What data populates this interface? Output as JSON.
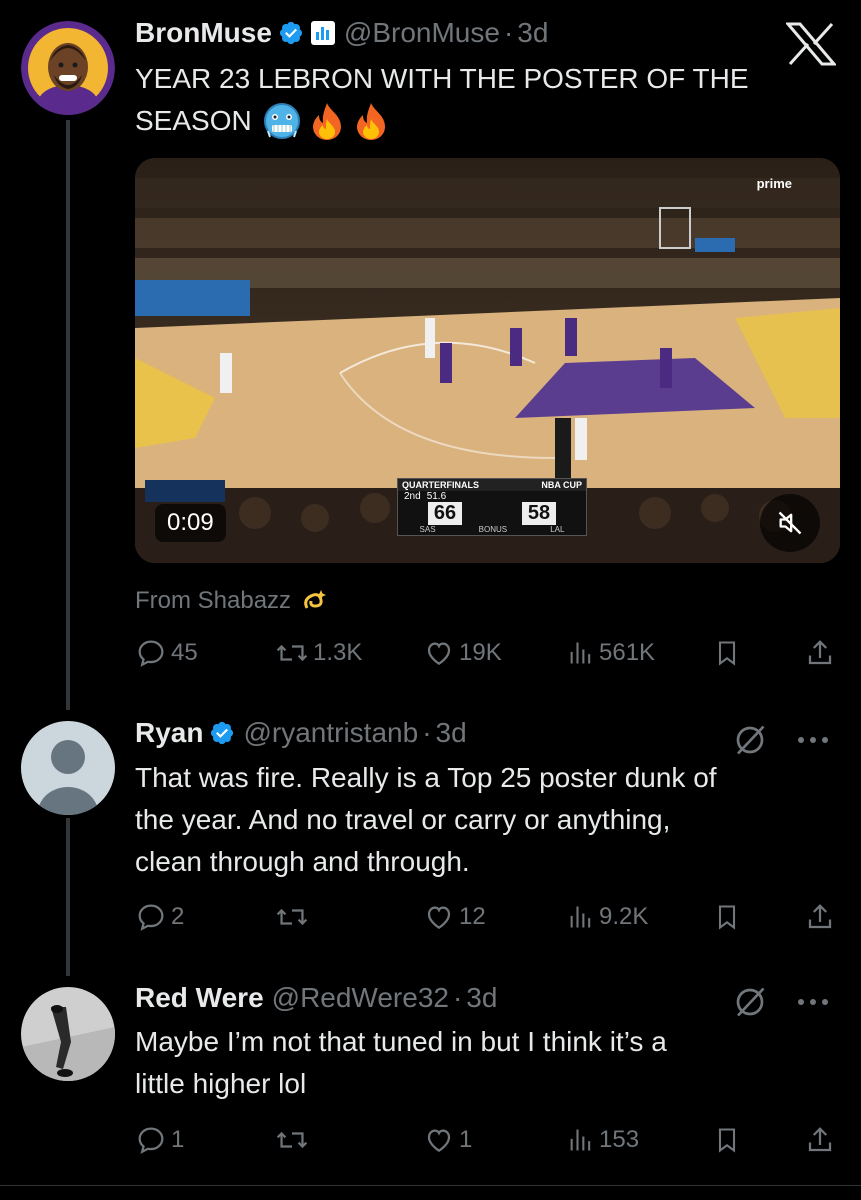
{
  "tweet1": {
    "name": "BronMuse",
    "handle": "@BronMuse",
    "dot": "·",
    "time": "3d",
    "text_line1": "YEAR 23 LEBRON WITH THE POSTER OF THE",
    "text_line2": "SEASON",
    "emojis": [
      "cold-face-icon",
      "fire-icon",
      "fire-icon"
    ],
    "video": {
      "duration": "0:09",
      "scorebug_stage": "QUARTERFINALS",
      "scorebug_cup": "NBA CUP",
      "quarter": "2nd",
      "clock": "51.6",
      "away_score": "66",
      "home_score": "58",
      "away_team": "SAS",
      "home_team": "LAL",
      "bonus": "BONUS",
      "broadcaster": "prime"
    },
    "from_label": "From Shabazz",
    "stats": {
      "replies": "45",
      "reposts": "1.3K",
      "likes": "19K",
      "views": "561K"
    }
  },
  "reply1": {
    "name": "Ryan",
    "handle": "@ryantristanb",
    "dot": "·",
    "time": "3d",
    "lines": [
      "That was fire. Really is a Top 25 poster dunk of",
      "the year. And no travel or carry or anything,",
      "clean through and through."
    ],
    "stats": {
      "replies": "2",
      "reposts": "",
      "likes": "12",
      "views": "9.2K"
    }
  },
  "reply2": {
    "name": "Red Were",
    "handle": "@RedWere32",
    "dot": "·",
    "time": "3d",
    "lines": [
      "Maybe I’m not that tuned in but I think it’s a",
      "little higher lol"
    ],
    "stats": {
      "replies": "1",
      "reposts": "",
      "likes": "1",
      "views": "153"
    }
  },
  "colors": {
    "background": "#000000",
    "text": "#e7e9ea",
    "secondary": "#71767b",
    "verified": "#1d9bf0",
    "thread_line": "#333639"
  }
}
